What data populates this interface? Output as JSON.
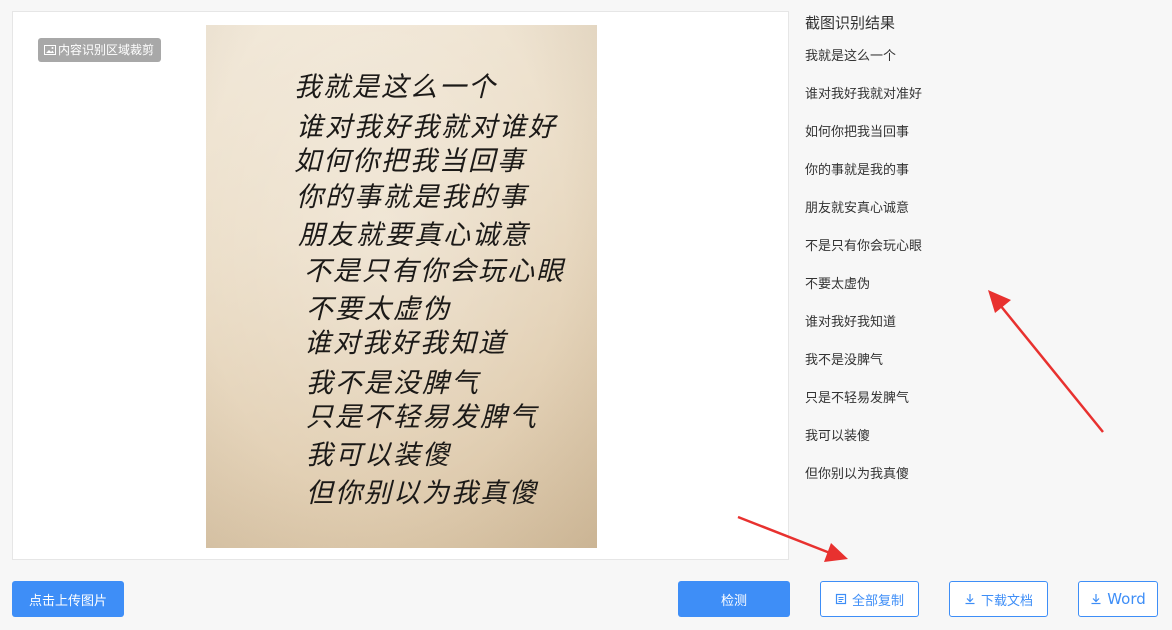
{
  "crop_tag": {
    "label": "内容识别区域裁剪",
    "icon": "image-icon"
  },
  "photo_lines": [
    "我就是这么一个",
    "谁对我好我就对谁好",
    "如何你把我当回事",
    "你的事就是我的事",
    "朋友就要真心诚意",
    "不是只有你会玩心眼",
    "不要太虚伪",
    "谁对我好我知道",
    "我不是没脾气",
    "只是不轻易发脾气",
    "我可以装傻",
    "但你别以为我真傻"
  ],
  "result": {
    "title": "截图识别结果",
    "lines": [
      "我就是这么一个",
      "谁对我好我就对准好",
      "如何你把我当回事",
      "你的事就是我的事",
      "朋友就安真心诚意",
      "不是只有你会玩心眼",
      "不要太虚伪",
      "谁对我好我知道",
      "我不是没脾气",
      "只是不轻易发脾气",
      "我可以装傻",
      "但你别以为我真傻"
    ]
  },
  "buttons": {
    "upload": "点击上传图片",
    "detect": "检测",
    "copy_all": "全部复制",
    "download_doc": "下载文档",
    "word": "Word"
  },
  "colors": {
    "primary": "#3e8ef7",
    "arrow": "#e8312f"
  }
}
